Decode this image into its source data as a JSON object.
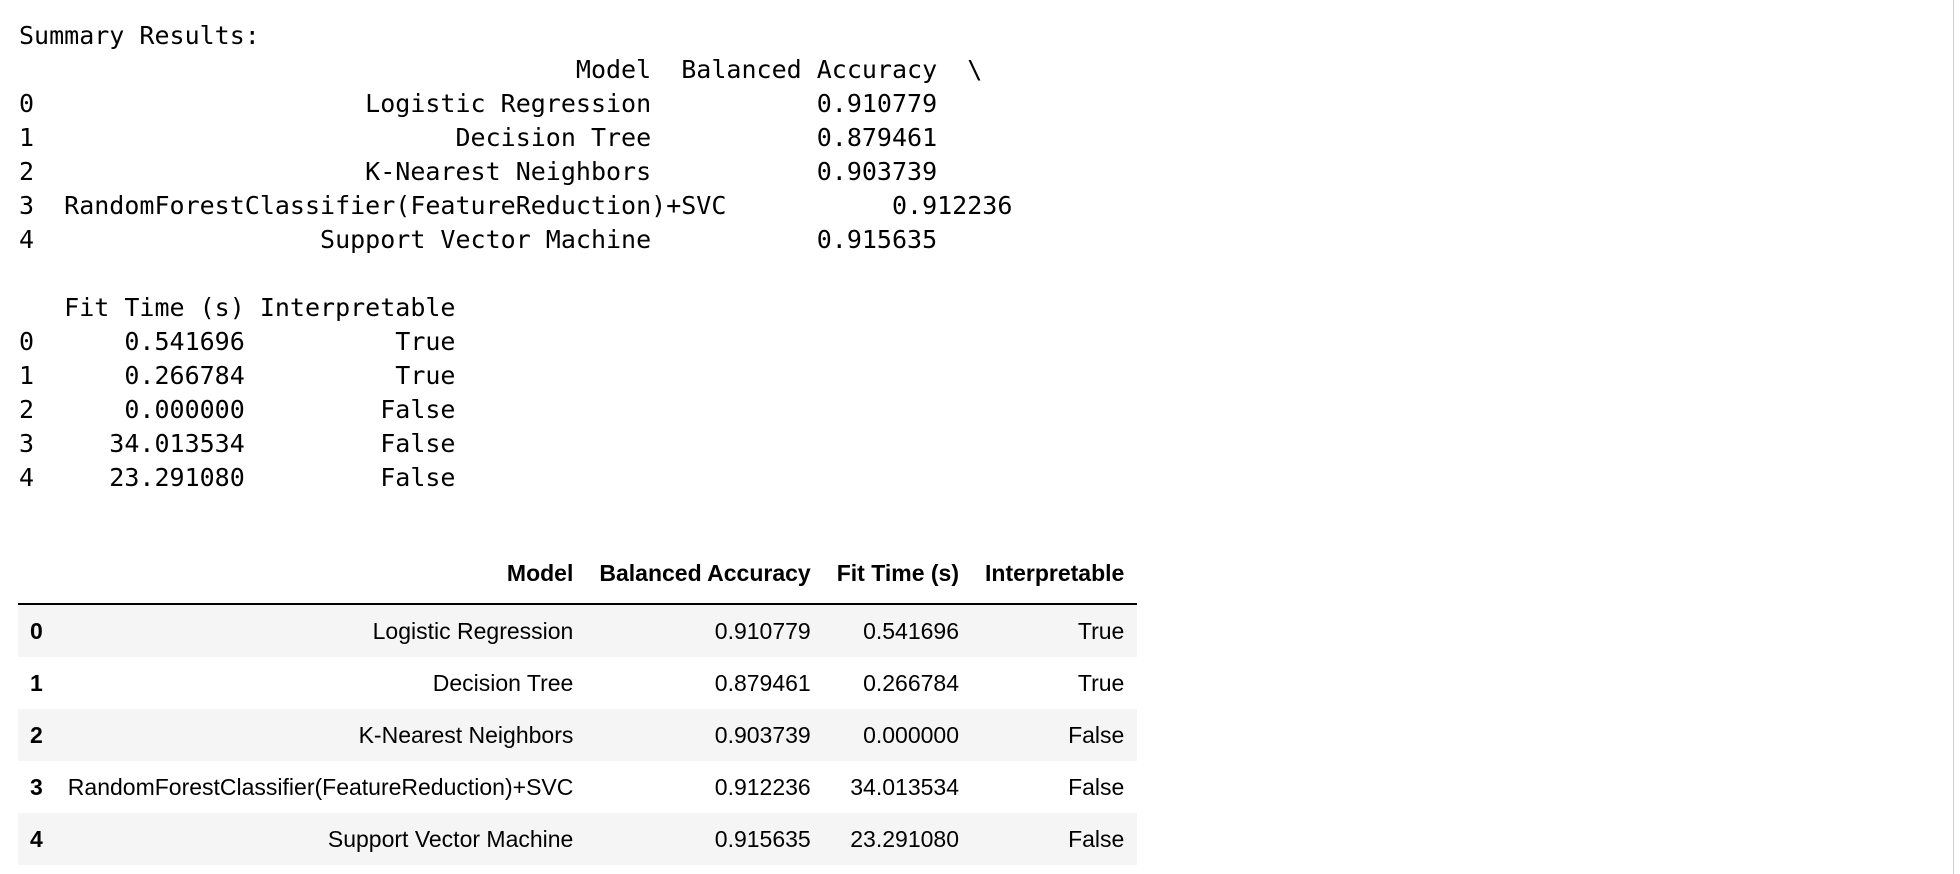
{
  "console_output": {
    "lines": [
      "Summary Results:",
      "                                     Model  Balanced Accuracy  \\",
      "0                      Logistic Regression           0.910779   ",
      "1                            Decision Tree           0.879461   ",
      "2                      K-Nearest Neighbors           0.903739   ",
      "3  RandomForestClassifier(FeatureReduction)+SVC           0.912236   ",
      "4                   Support Vector Machine           0.915635   ",
      "",
      "   Fit Time (s) Interpretable  ",
      "0      0.541696          True  ",
      "1      0.266784          True  ",
      "2      0.000000         False  ",
      "3     34.013534         False  ",
      "4     23.291080         False  "
    ]
  },
  "dataframe": {
    "columns": [
      "",
      "Model",
      "Balanced Accuracy",
      "Fit Time (s)",
      "Interpretable"
    ],
    "rows": [
      {
        "index": "0",
        "model": "Logistic Regression",
        "balanced_accuracy": "0.910779",
        "fit_time": "0.541696",
        "interpretable": "True"
      },
      {
        "index": "1",
        "model": "Decision Tree",
        "balanced_accuracy": "0.879461",
        "fit_time": "0.266784",
        "interpretable": "True"
      },
      {
        "index": "2",
        "model": "K-Nearest Neighbors",
        "balanced_accuracy": "0.903739",
        "fit_time": "0.000000",
        "interpretable": "False"
      },
      {
        "index": "3",
        "model": "RandomForestClassifier(FeatureReduction)+SVC",
        "balanced_accuracy": "0.912236",
        "fit_time": "34.013534",
        "interpretable": "False"
      },
      {
        "index": "4",
        "model": "Support Vector Machine",
        "balanced_accuracy": "0.915635",
        "fit_time": "23.291080",
        "interpretable": "False"
      }
    ]
  }
}
